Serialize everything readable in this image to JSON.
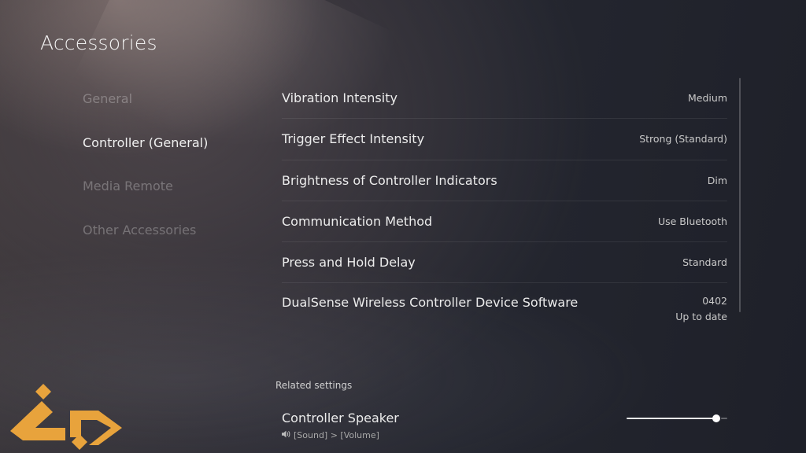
{
  "page": {
    "title": "Accessories"
  },
  "sidebar": {
    "items": [
      {
        "label": "General",
        "active": false
      },
      {
        "label": "Controller (General)",
        "active": true
      },
      {
        "label": "Media Remote",
        "active": false
      },
      {
        "label": "Other Accessories",
        "active": false
      }
    ]
  },
  "settings": [
    {
      "label": "Vibration Intensity",
      "value": "Medium"
    },
    {
      "label": "Trigger Effect Intensity",
      "value": "Strong (Standard)"
    },
    {
      "label": "Brightness of Controller Indicators",
      "value": "Dim"
    },
    {
      "label": "Communication Method",
      "value": "Use Bluetooth"
    },
    {
      "label": "Press and Hold Delay",
      "value": "Standard"
    },
    {
      "label": "DualSense Wireless Controller Device Software",
      "value": "0402",
      "sub_value": "Up to date"
    }
  ],
  "related": {
    "header": "Related settings",
    "item": {
      "title": "Controller Speaker",
      "path": "[Sound] > [Volume]",
      "path_icon": "speaker-icon",
      "volume_level": 0.89
    }
  },
  "colors": {
    "logo_gold": "#e8a33c",
    "text_primary": "#ececec",
    "text_dim": "rgba(255,255,255,0.28)"
  },
  "logo": {
    "icon": "site-logo-icon"
  }
}
